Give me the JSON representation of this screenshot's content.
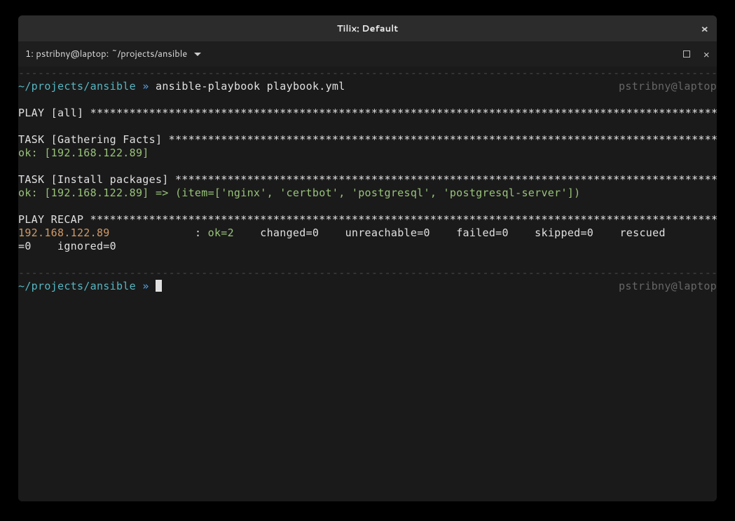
{
  "window": {
    "title": "Tilix: Default"
  },
  "tab": {
    "title": "1: pstribny@laptop: ~/projects/ansible"
  },
  "prompt": {
    "path": "~/projects/ansible",
    "separator": "»",
    "userhost": "pstribny@laptop"
  },
  "command": "ansible-playbook playbook.yml",
  "output": {
    "dashline": "------------------------------------------------------------------------------------------------------------",
    "play_header": "PLAY [all] *************************************************************************************************",
    "task_gathering": "TASK [Gathering Facts] *************************************************************************************",
    "ok_gathering": "ok: [192.168.122.89]",
    "task_install": "TASK [Install packages] ************************************************************************************",
    "ok_install": "ok: [192.168.122.89] => (item=['nginx', 'certbot', 'postgresql', 'postgresql-server'])",
    "recap_header": "PLAY RECAP *************************************************************************************************",
    "recap_host": "192.168.122.89",
    "recap_colon": "             : ",
    "recap_ok": "ok=2   ",
    "recap_rest1": " changed=0    unreachable=0    failed=0    skipped=0    rescued",
    "recap_rest2": "=0    ignored=0"
  }
}
